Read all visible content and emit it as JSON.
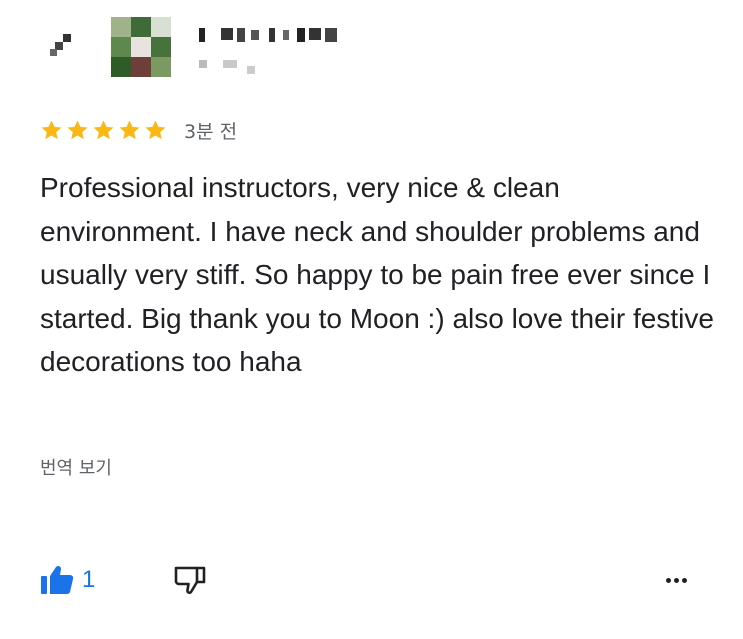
{
  "review": {
    "rating": 5,
    "max_rating": 5,
    "time_ago": "3분 전",
    "text": "Professional instructors, very nice & clean environment. I have neck and shoulder problems and usually very stiff. So happy to be pain free ever since I started. Big thank you to Moon :) also love their festive decorations too haha",
    "translate_label": "번역 보기",
    "like_count": "1"
  },
  "colors": {
    "star": "#f9b813",
    "like": "#1a73e8",
    "text": "#202124",
    "muted": "#5f6368"
  },
  "icons": {
    "like": "thumbs-up-icon",
    "dislike": "thumbs-down-icon",
    "more": "more-horizontal-icon"
  }
}
